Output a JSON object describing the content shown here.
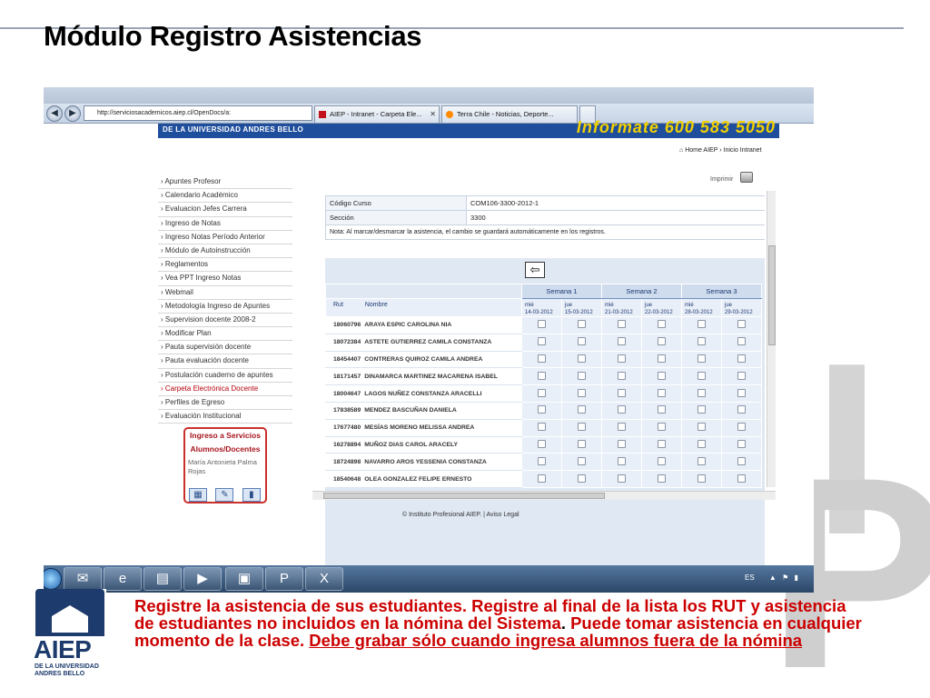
{
  "slide": {
    "title": "Módulo Registro Asistencias"
  },
  "browser": {
    "url": "http://serviciosacademicos.aiep.cl/OpenDocs/a:",
    "tabs": [
      {
        "label": "AIEP - Intranet - Carpeta Ele..."
      },
      {
        "label": "Terra Chile - Noticias, Deporte..."
      }
    ]
  },
  "page": {
    "header_left": "DE LA UNIVERSIDAD ANDRES BELLO",
    "header_promo": "Informate 600 583 5050",
    "breadcrumb_home": "Home AIEP",
    "breadcrumb_sep": "›",
    "breadcrumb_current": "Inicio Intranet",
    "print_label": "Imprimir",
    "footer": "© Instituto Profesional AIEP. | Aviso Legal"
  },
  "sidebar": {
    "items": [
      {
        "label": "› Apuntes Profesor"
      },
      {
        "label": "› Calendario Académico"
      },
      {
        "label": "› Evaluacion Jefes Carrera"
      },
      {
        "label": "› Ingreso de Notas"
      },
      {
        "label": "› Ingreso Notas Período Anterior"
      },
      {
        "label": "› Módulo de Autoinstrucción"
      },
      {
        "label": "› Reglamentos"
      },
      {
        "label": "› Vea PPT Ingreso Notas"
      },
      {
        "label": "› Webmail"
      },
      {
        "label": "› Metodología Ingreso de Apuntes"
      },
      {
        "label": "› Supervision docente 2008-2"
      },
      {
        "label": "› Modificar Plan"
      },
      {
        "label": "› Pauta supervisión docente"
      },
      {
        "label": "› Pauta evaluación docente"
      },
      {
        "label": "› Postulación cuaderno de apuntes"
      },
      {
        "label": "› Carpeta Electrónica Docente"
      },
      {
        "label": "› Perfiles de Egreso"
      },
      {
        "label": "› Evaluación Institucional"
      }
    ]
  },
  "services_box": {
    "title_line1": "Ingreso a Servicios",
    "title_line2": "Alumnos/Docentes",
    "user": "María Antonieta Palma Rojas"
  },
  "course": {
    "code_label": "Código Curso",
    "code_value": "COM106-3300-2012-1",
    "section_label": "Sección",
    "section_value": "3300",
    "note": "Nota: Al marcar/desmarcar la asistencia, el cambio se guardará automáticamente en los registros."
  },
  "attendance": {
    "col_rut": "Rut",
    "col_name": "Nombre",
    "weeks": [
      "Semana 1",
      "Semana 2",
      "Semana 3"
    ],
    "days": [
      {
        "day": "mié",
        "date": "14-03-2012"
      },
      {
        "day": "jue",
        "date": "15-03-2012"
      },
      {
        "day": "mié",
        "date": "21-03-2012"
      },
      {
        "day": "jue",
        "date": "22-03-2012"
      },
      {
        "day": "mié",
        "date": "28-03-2012"
      },
      {
        "day": "jue",
        "date": "29-03-2012"
      }
    ],
    "students": [
      {
        "rut": "18060796",
        "name": "ARAYA ESPIC CAROLINA NIA"
      },
      {
        "rut": "18072384",
        "name": "ASTETE GUTIERREZ CAMILA CONSTANZA"
      },
      {
        "rut": "18454407",
        "name": "CONTRERAS QUIROZ CAMILA ANDREA"
      },
      {
        "rut": "18171457",
        "name": "DINAMARCA MARTINEZ MACARENA ISABEL"
      },
      {
        "rut": "18004647",
        "name": "LAGOS NUÑEZ CONSTANZA ARACELLI"
      },
      {
        "rut": "17838589",
        "name": "MENDEZ BASCUÑAN DANIELA"
      },
      {
        "rut": "17677480",
        "name": "MESÍAS MORENO MELISSA ANDREA"
      },
      {
        "rut": "16278894",
        "name": "MUÑOZ DIAS CAROL ARACELY"
      },
      {
        "rut": "18724898",
        "name": "NAVARRO AROS YESSENIA CONSTANZA"
      },
      {
        "rut": "18540648",
        "name": "OLEA GONZALEZ FELIPE ERNESTO"
      }
    ]
  },
  "taskbar": {
    "tray_lang": "ES"
  },
  "logo": {
    "name": "AIEP",
    "sub_line1": "DE LA UNIVERSIDAD",
    "sub_line2": "ANDRES BELLO"
  },
  "caption": {
    "part1": "Registre la asistencia de sus estudiantes. Registre al final de la lista los RUT y asistencia de estudiantes no incluidos en la nómina del Sistema",
    "part2": ". ",
    "part3": "Puede tomar asistencia en cualquier momento de la clase. ",
    "part4": "Debe grabar sólo cuando ingresa alumnos fuera de la nómina"
  },
  "colors": {
    "header_blue": "#1f4e9c",
    "caption_red": "#cc0000",
    "active_link_red": "#b5000b",
    "logo_blue": "#1e3b6d"
  }
}
